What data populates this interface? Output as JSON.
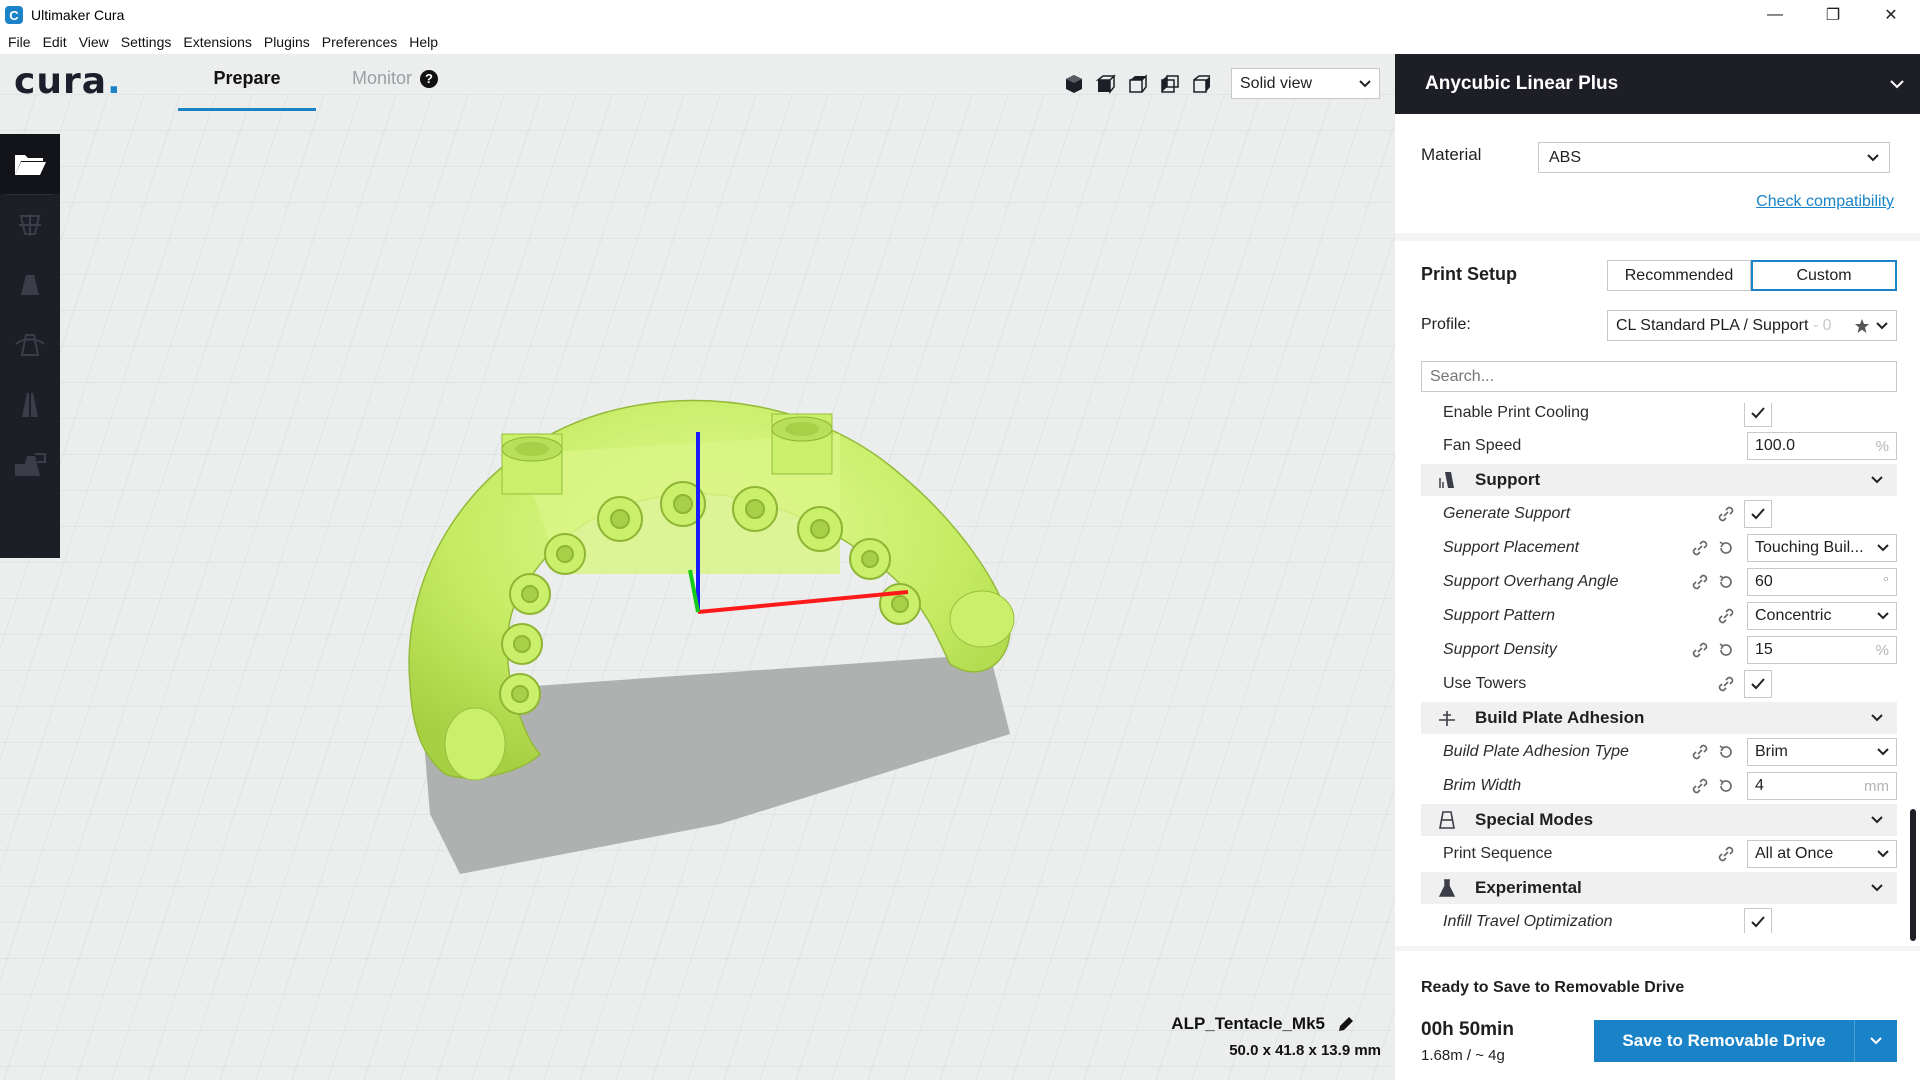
{
  "window": {
    "title": "Ultimaker Cura",
    "minimize": "—",
    "restore": "❐",
    "close": "✕"
  },
  "menu": [
    "File",
    "Edit",
    "View",
    "Settings",
    "Extensions",
    "Plugins",
    "Preferences",
    "Help"
  ],
  "header": {
    "logo": "cura",
    "tabs": {
      "prepare": "Prepare",
      "monitor": "Monitor"
    },
    "help_glyph": "?",
    "view_mode": "Solid view"
  },
  "toolbar": {
    "tools": [
      "open-folder-icon",
      "move-icon",
      "scale-icon",
      "rotate-icon",
      "mirror-icon",
      "per-model-settings-icon"
    ]
  },
  "object": {
    "name": "ALP_Tentacle_Mk5",
    "dimensions": "50.0 x 41.8 x 13.9 mm"
  },
  "panel": {
    "printer": "Anycubic Linear Plus",
    "material_label": "Material",
    "material_value": "ABS",
    "check_compatibility": "Check compatibility",
    "print_setup": "Print Setup",
    "mode_recommended": "Recommended",
    "mode_custom": "Custom",
    "profile_label": "Profile:",
    "profile_value": "CL Standard PLA / Support",
    "profile_fade": " - 0",
    "search_placeholder": "Search..."
  },
  "settings": {
    "enable_print_cooling": {
      "label": "Enable Print Cooling",
      "checked": true
    },
    "fan_speed": {
      "label": "Fan Speed",
      "value": "100.0",
      "unit": "%"
    },
    "cat_support": "Support",
    "generate_support": {
      "label": "Generate Support",
      "checked": true
    },
    "support_placement": {
      "label": "Support Placement",
      "value": "Touching Buil..."
    },
    "support_overhang_angle": {
      "label": "Support Overhang Angle",
      "value": "60",
      "unit": "°"
    },
    "support_pattern": {
      "label": "Support Pattern",
      "value": "Concentric"
    },
    "support_density": {
      "label": "Support Density",
      "value": "15",
      "unit": "%"
    },
    "use_towers": {
      "label": "Use Towers",
      "checked": true
    },
    "cat_adhesion": "Build Plate Adhesion",
    "adhesion_type": {
      "label": "Build Plate Adhesion Type",
      "value": "Brim"
    },
    "brim_width": {
      "label": "Brim Width",
      "value": "4",
      "unit": "mm"
    },
    "cat_special": "Special Modes",
    "print_sequence": {
      "label": "Print Sequence",
      "value": "All at Once"
    },
    "cat_experimental": "Experimental",
    "infill_travel": {
      "label": "Infill Travel Optimization",
      "checked": true
    }
  },
  "output": {
    "status": "Ready to Save to Removable Drive",
    "time": "00h 50min",
    "usage": "1.68m / ~ 4g",
    "save_button": "Save to Removable Drive"
  },
  "colors": {
    "accent": "#1a83c8",
    "dark": "#1d1e26",
    "model": "#c9f26b"
  }
}
